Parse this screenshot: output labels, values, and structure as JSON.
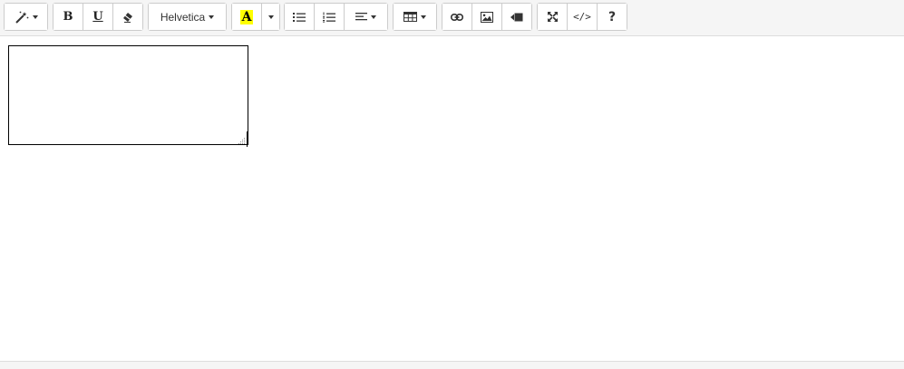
{
  "toolbar": {
    "style_menu_icon": "magic-wand-icon",
    "bold_label": "B",
    "underline_label": "U",
    "clear_format_icon": "eraser-icon",
    "font_name": "Helvetica",
    "color_label": "A",
    "highlight_color": "#ffff00",
    "unordered_list_icon": "unordered-list-icon",
    "ordered_list_icon": "ordered-list-icon",
    "paragraph_icon": "align-left-icon",
    "table_icon": "table-icon",
    "link_icon": "link-icon",
    "picture_icon": "picture-icon",
    "video_icon": "video-icon",
    "fullscreen_icon": "fullscreen-icon",
    "codeview_label": "</>",
    "help_label": "?"
  },
  "editor": {
    "textarea_value": ""
  }
}
